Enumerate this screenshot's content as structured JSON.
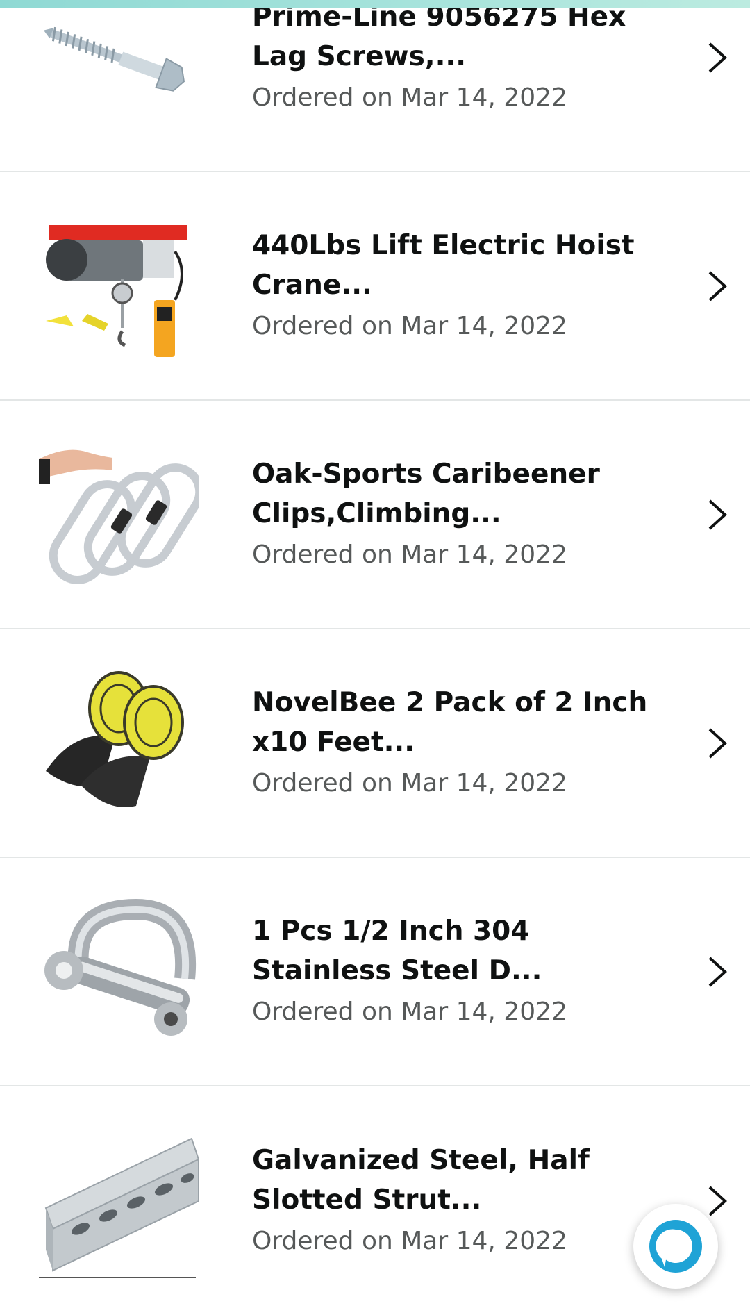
{
  "orders": [
    {
      "title": "Prime-Line 9056275 Hex Lag Screws,...",
      "date": "Ordered on Mar 14, 2022",
      "icon": "hex-lag-screw-image"
    },
    {
      "title": "440Lbs Lift Electric Hoist Crane...",
      "date": "Ordered on Mar 14, 2022",
      "icon": "electric-hoist-image"
    },
    {
      "title": "Oak-Sports Caribeener Clips,Climbing...",
      "date": "Ordered on Mar 14, 2022",
      "icon": "carabiner-clips-image"
    },
    {
      "title": "NovelBee 2 Pack of 2 Inch x10 Feet...",
      "date": "Ordered on Mar 14, 2022",
      "icon": "tow-straps-image"
    },
    {
      "title": "1 Pcs 1/2 Inch 304 Stainless Steel D...",
      "date": "Ordered on Mar 14, 2022",
      "icon": "d-ring-shackle-image"
    },
    {
      "title": "Galvanized Steel, Half Slotted Strut...",
      "date": "Ordered on Mar 14, 2022",
      "icon": "slotted-strut-image"
    }
  ],
  "colors": {
    "title": "#0f1111",
    "date": "#565959",
    "divider": "#e3e6e6",
    "accent": "#8fd9d4",
    "alexa": "#1fa3d6"
  }
}
